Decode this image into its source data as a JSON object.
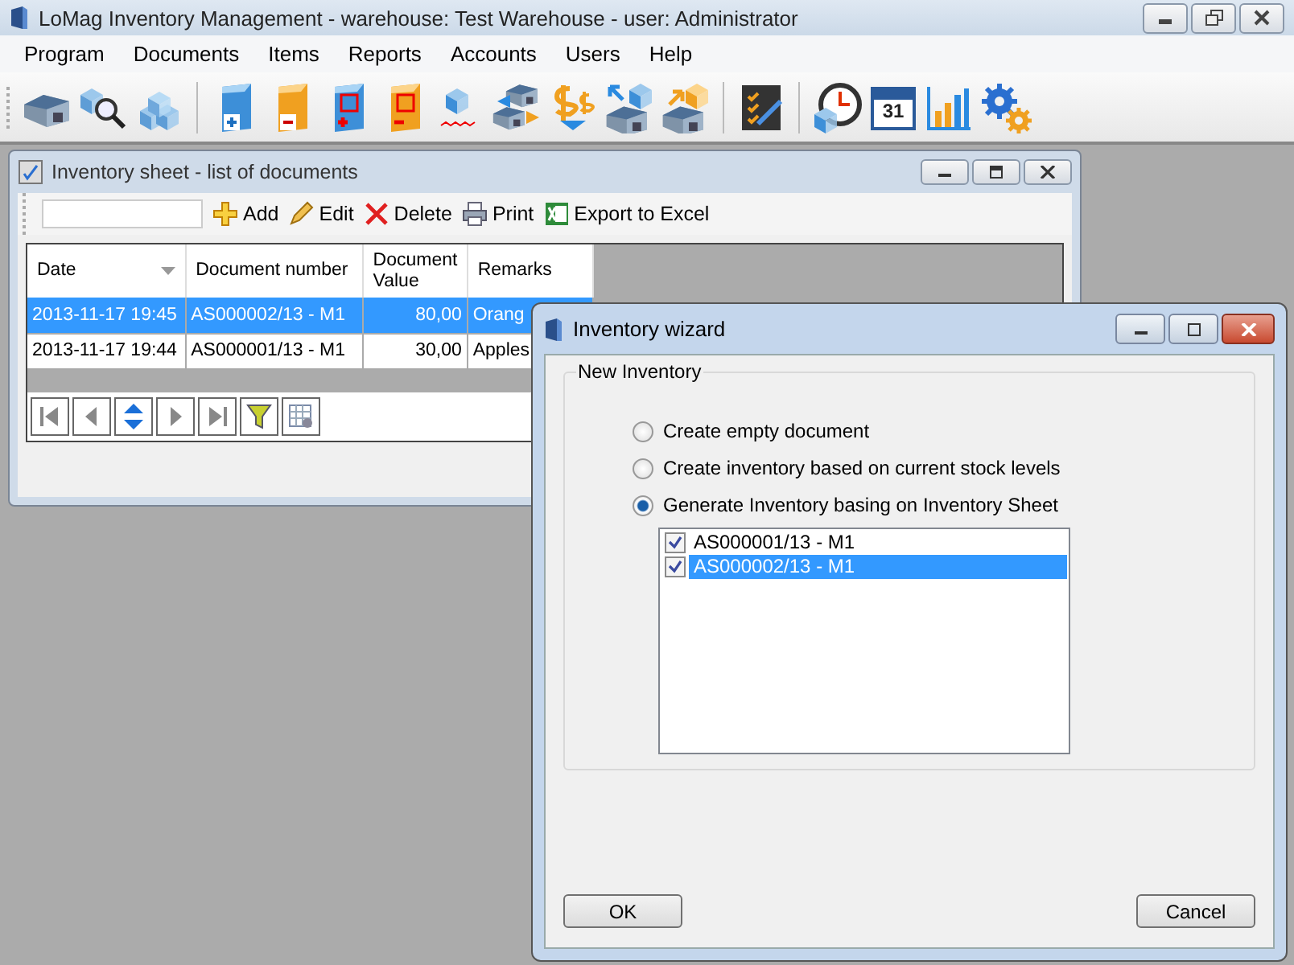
{
  "window": {
    "title": "LoMag Inventory Management - warehouse: Test Warehouse - user: Administrator"
  },
  "menu": [
    "Program",
    "Documents",
    "Items",
    "Reports",
    "Accounts",
    "Users",
    "Help"
  ],
  "toolbar": {
    "calendar_day": "31"
  },
  "documents_window": {
    "title": "Inventory sheet - list of documents",
    "actions": [
      {
        "kind": "add",
        "label": "Add"
      },
      {
        "kind": "edit",
        "label": "Edit"
      },
      {
        "kind": "delete",
        "label": "Delete"
      },
      {
        "kind": "print",
        "label": "Print"
      },
      {
        "kind": "excel",
        "label": "Export to Excel"
      }
    ],
    "table": {
      "columns": [
        {
          "label": "Date",
          "sorted": true
        },
        {
          "label": "Document number",
          "sorted": false
        },
        {
          "label": "Document Value",
          "sorted": false
        },
        {
          "label": "Remarks",
          "sorted": false
        }
      ],
      "rows": [
        {
          "selected": true,
          "cells": [
            "2013-11-17 19:45",
            "AS000002/13 - M1",
            "80,00",
            "Orang"
          ]
        },
        {
          "selected": false,
          "cells": [
            "2013-11-17 19:44",
            "AS000001/13 - M1",
            "30,00",
            "Apples"
          ]
        }
      ]
    }
  },
  "wizard": {
    "title": "Inventory wizard",
    "group_label": "New Inventory",
    "options": [
      {
        "label": "Create empty document",
        "selected": false
      },
      {
        "label": "Create inventory based on current stock levels",
        "selected": false
      },
      {
        "label": "Generate Inventory basing on Inventory Sheet",
        "selected": true
      }
    ],
    "sheets": [
      {
        "label": "AS000001/13 - M1",
        "checked": true,
        "selected": false
      },
      {
        "label": "AS000002/13 - M1",
        "checked": true,
        "selected": true
      }
    ],
    "buttons": [
      "OK",
      "Cancel"
    ]
  }
}
